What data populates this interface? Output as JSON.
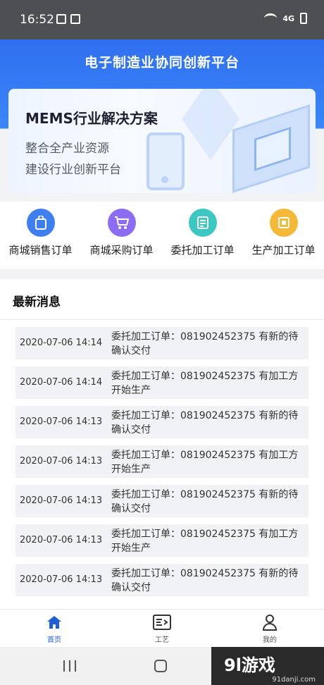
{
  "status_bar": {
    "time": "16:52",
    "signal": "4G"
  },
  "header": {
    "title": "电子制造业协同创新平台"
  },
  "banner": {
    "title": "MEMS行业解决方案",
    "line1": "整合全产业资源",
    "line2": "建设行业创新平台"
  },
  "quick_menu": [
    {
      "label": "商城销售订单",
      "icon": "shopping-bag-icon",
      "color": "#3e7ff0"
    },
    {
      "label": "商城采购订单",
      "icon": "cart-icon",
      "color": "#8b6cf2"
    },
    {
      "label": "委托加工订单",
      "icon": "document-icon",
      "color": "#3cc7c3"
    },
    {
      "label": "生产加工订单",
      "icon": "factory-icon",
      "color": "#f5b938"
    }
  ],
  "news": {
    "title": "最新消息",
    "items": [
      {
        "date": "2020-07-06 14:14",
        "message": "委托加工订单：081902452375 有新的待确认交付"
      },
      {
        "date": "2020-07-06 14:14",
        "message": "委托加工订单：081902452375 有加工方开始生产"
      },
      {
        "date": "2020-07-06 14:13",
        "message": "委托加工订单：081902452375 有新的待确认交付"
      },
      {
        "date": "2020-07-06 14:13",
        "message": "委托加工订单：081902452375 有加工方开始生产"
      },
      {
        "date": "2020-07-06 14:13",
        "message": "委托加工订单：081902452375 有新的待确认交付"
      },
      {
        "date": "2020-07-06 14:13",
        "message": "委托加工订单：081902452375 有加工方开始生产"
      },
      {
        "date": "2020-07-06 14:13",
        "message": "委托加工订单：081902452375 有新的待确认交付"
      }
    ]
  },
  "tab_bar": [
    {
      "label": "首页",
      "icon": "home-icon",
      "active": true
    },
    {
      "label": "工艺",
      "icon": "process-icon",
      "active": false
    },
    {
      "label": "我的",
      "icon": "user-icon",
      "active": false
    }
  ],
  "watermark": {
    "brand": "9l游戏",
    "url": "91danji.com"
  },
  "colors": {
    "primary": "#2f6ff0",
    "active_tab": "#1f5fd3"
  }
}
